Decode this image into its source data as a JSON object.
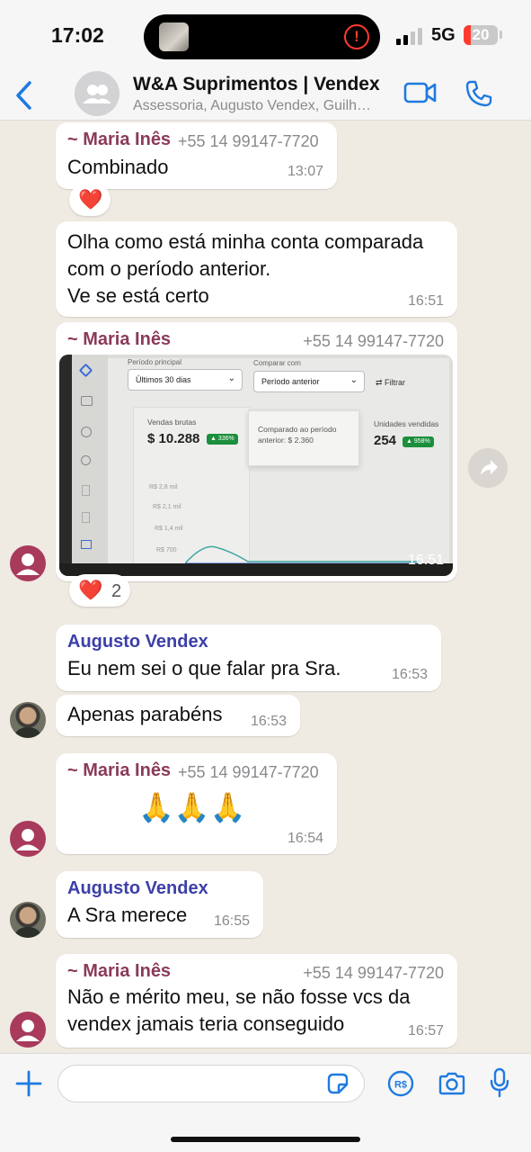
{
  "status_bar": {
    "time": "17:02",
    "network": "5G",
    "battery": "20",
    "battery_percent": 20,
    "alert_symbol": "!"
  },
  "header": {
    "title": "W&A Suprimentos | Vendex",
    "subtitle": "Assessoria, Augusto Vendex, Guilh…"
  },
  "messages": [
    {
      "sender": "~ Maria Inês",
      "phone": "+55 14 99147-7720",
      "text": "Combinado",
      "time": "13:07"
    },
    {
      "reaction": "❤️"
    },
    {
      "text_lines": [
        "Olha como está minha conta comparada",
        "com o período anterior.",
        "Ve se está certo"
      ],
      "time": "16:51"
    },
    {
      "sender": "~ Maria Inês",
      "phone": "+55 14 99147-7720",
      "time": "16:51",
      "photo": {
        "periodo_label": "Período principal",
        "periodo_value": "Últimos 30 dias",
        "comparar_label": "Comparar com",
        "comparar_value": "Período anterior",
        "filtrar": "Filtrar",
        "vendas_label": "Vendas brutas",
        "vendas_value": "$ 10.288",
        "vendas_badge": "▲ 336%",
        "comparado_text": "Comparado ao período anterior: $ 2.360",
        "unidades_label": "Unidades vendidas",
        "unidades_value": "254",
        "unidades_badge": "▲ 958%",
        "axis": [
          "R$ 2,8 mil",
          "R$ 2,1 mil",
          "R$ 1,4 mil",
          "R$ 700"
        ]
      },
      "reaction": "❤️",
      "reaction_count": "2"
    },
    {
      "sender": "Augusto Vendex",
      "text": "Eu nem sei o que falar pra Sra.",
      "time": "16:53"
    },
    {
      "text": "Apenas parabéns",
      "time": "16:53"
    },
    {
      "sender": "~ Maria Inês",
      "phone": "+55 14 99147-7720",
      "text": "🙏🙏🙏",
      "time": "16:54"
    },
    {
      "sender": "Augusto Vendex",
      "text": "A Sra merece",
      "time": "16:55"
    },
    {
      "sender": "~ Maria Inês",
      "phone": "+55 14 99147-7720",
      "text_lines": [
        "Não e mérito meu, se não fosse vcs da",
        "vendex jamais teria conseguido"
      ],
      "time": "16:57"
    }
  ],
  "input": {
    "placeholder": "",
    "value": ""
  },
  "colors": {
    "accent": "#1f7ae0",
    "maria_name": "#8b3a5a",
    "augusto_name": "#3c3fa8",
    "background": "#efeae2"
  }
}
